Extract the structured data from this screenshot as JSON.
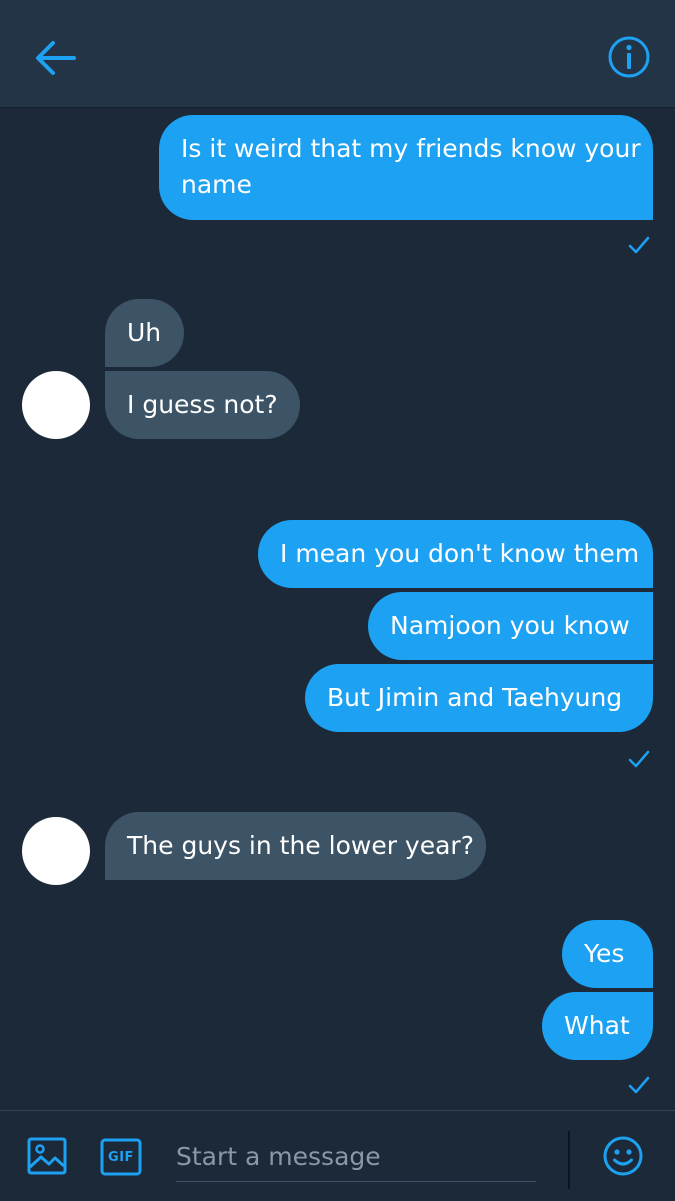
{
  "colors": {
    "background": "#1c2938",
    "header": "#243447",
    "accent": "#1da1f2",
    "received_bubble": "#3d5466",
    "avatar": "#ffffff"
  },
  "header": {
    "back_icon": "arrow-left-icon",
    "info_icon": "info-icon"
  },
  "messages": [
    {
      "from": "me",
      "lines": [
        "Is it weird that my friends know your",
        "name"
      ]
    },
    {
      "from": "them",
      "text": "Uh"
    },
    {
      "from": "them",
      "text": "I guess not?"
    },
    {
      "from": "me",
      "text": "I mean you don't know them"
    },
    {
      "from": "me",
      "text": "Namjoon you know"
    },
    {
      "from": "me",
      "text": "But Jimin and Taehyung"
    },
    {
      "from": "them",
      "text": "The guys in the lower year?"
    },
    {
      "from": "me",
      "text": "Yes"
    },
    {
      "from": "me",
      "text": "What"
    }
  ],
  "composer": {
    "placeholder": "Start a message",
    "image_icon": "image-icon",
    "gif_label": "GIF",
    "emoji_icon": "emoji-icon"
  }
}
